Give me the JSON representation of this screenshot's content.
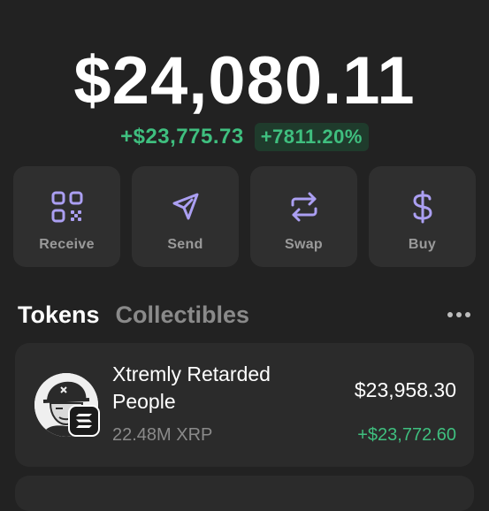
{
  "portfolio": {
    "balance": "$24,080.11",
    "change_abs": "+$23,775.73",
    "change_pct": "+7811.20%"
  },
  "actions": [
    {
      "label": "Receive",
      "icon": "qr-code-icon"
    },
    {
      "label": "Send",
      "icon": "send-icon"
    },
    {
      "label": "Swap",
      "icon": "swap-icon"
    },
    {
      "label": "Buy",
      "icon": "dollar-icon"
    }
  ],
  "tabs": [
    {
      "label": "Tokens",
      "active": true
    },
    {
      "label": "Collectibles",
      "active": false
    }
  ],
  "tokens": [
    {
      "name": "Xtremly Retarded People",
      "amount": "22.48M XRP",
      "value": "$23,958.30",
      "change": "+$23,772.60",
      "chain_icon": "solana-icon"
    }
  ],
  "colors": {
    "background": "#222222",
    "card": "#2f2f2f",
    "accent": "#ab9ff2",
    "positive": "#3fbf7f",
    "muted": "#9a9a9a"
  }
}
